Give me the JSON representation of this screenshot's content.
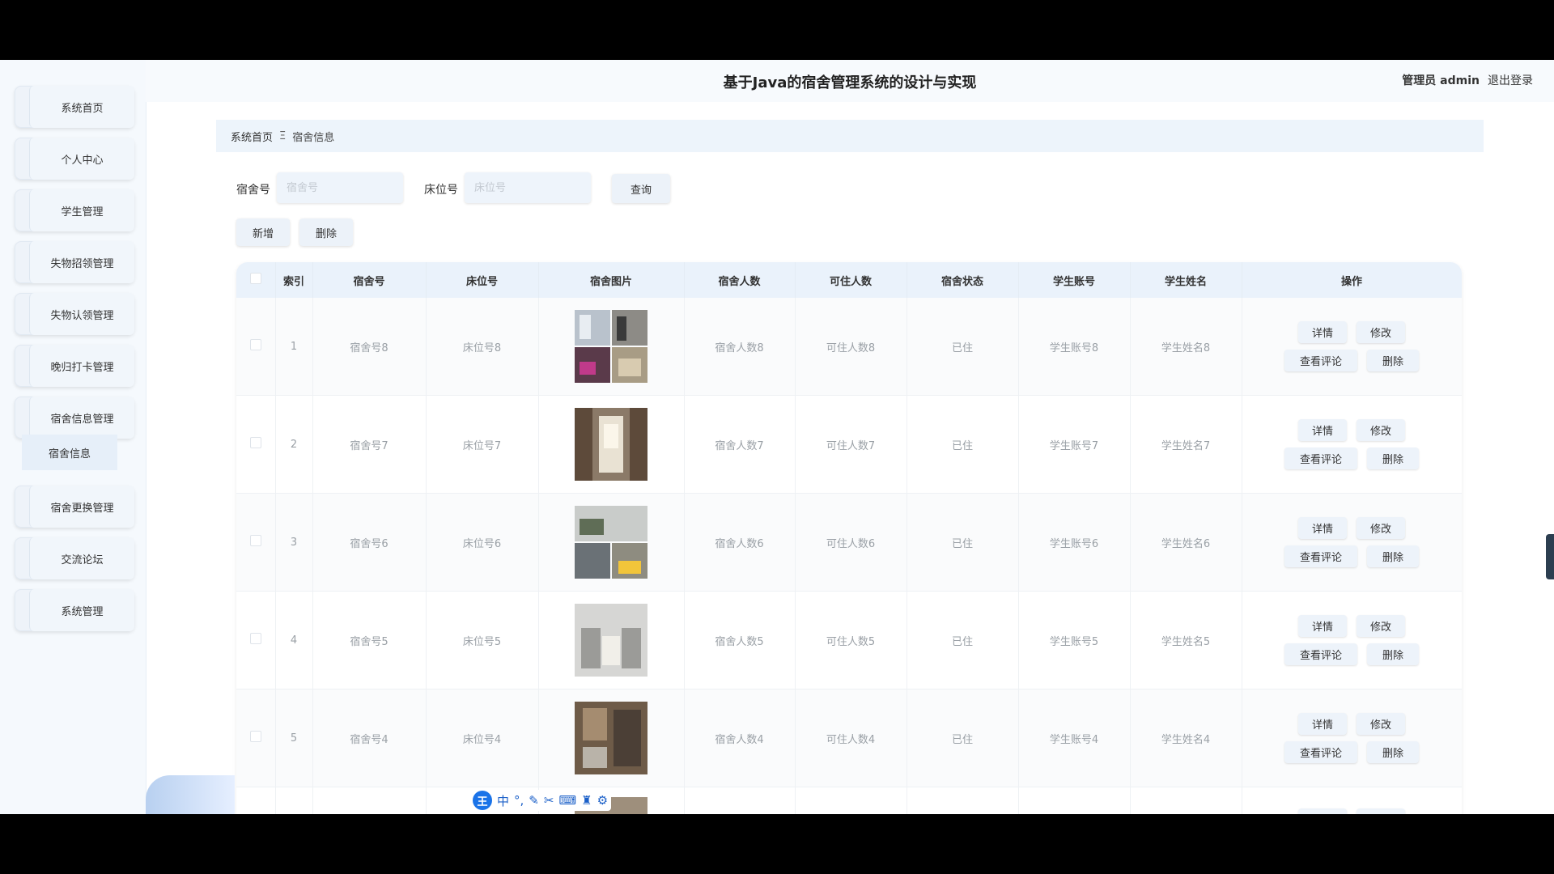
{
  "header": {
    "title": "基于Java的宿舍管理系统的设计与实现",
    "role": "管理员 admin",
    "logout": "退出登录"
  },
  "sidebar": {
    "items": [
      {
        "label": "系统首页"
      },
      {
        "label": "个人中心"
      },
      {
        "label": "学生管理"
      },
      {
        "label": "失物招领管理"
      },
      {
        "label": "失物认领管理"
      },
      {
        "label": "晚归打卡管理"
      },
      {
        "label": "宿舍信息管理"
      },
      {
        "label": "宿舍更换管理"
      },
      {
        "label": "交流论坛"
      },
      {
        "label": "系统管理"
      }
    ],
    "submenu": "宿舍信息"
  },
  "breadcrumb": {
    "home": "系统首页",
    "separator": "Ξ",
    "current": "宿舍信息"
  },
  "search": {
    "dorm_label": "宿舍号",
    "dorm_placeholder": "宿舍号",
    "bed_label": "床位号",
    "bed_placeholder": "床位号",
    "query": "查询"
  },
  "actions": {
    "add": "新增",
    "delete": "删除"
  },
  "table": {
    "headers": [
      "索引",
      "宿舍号",
      "床位号",
      "宿舍图片",
      "宿舍人数",
      "可住人数",
      "宿舍状态",
      "学生账号",
      "学生姓名",
      "操作"
    ],
    "rows": [
      {
        "index": "1",
        "dorm": "宿舍号8",
        "bed": "床位号8",
        "count": "宿舍人数8",
        "cap": "可住人数8",
        "status": "已住",
        "account": "学生账号8",
        "name": "学生姓名8"
      },
      {
        "index": "2",
        "dorm": "宿舍号7",
        "bed": "床位号7",
        "count": "宿舍人数7",
        "cap": "可住人数7",
        "status": "已住",
        "account": "学生账号7",
        "name": "学生姓名7"
      },
      {
        "index": "3",
        "dorm": "宿舍号6",
        "bed": "床位号6",
        "count": "宿舍人数6",
        "cap": "可住人数6",
        "status": "已住",
        "account": "学生账号6",
        "name": "学生姓名6"
      },
      {
        "index": "4",
        "dorm": "宿舍号5",
        "bed": "床位号5",
        "count": "宿舍人数5",
        "cap": "可住人数5",
        "status": "已住",
        "account": "学生账号5",
        "name": "学生姓名5"
      },
      {
        "index": "5",
        "dorm": "宿舍号4",
        "bed": "床位号4",
        "count": "宿舍人数4",
        "cap": "可住人数4",
        "status": "已住",
        "account": "学生账号4",
        "name": "学生姓名4"
      }
    ],
    "ops": {
      "detail": "详情",
      "edit": "修改",
      "comments": "查看评论",
      "delete": "删除"
    }
  },
  "ime": {
    "logo": "王",
    "lang": "中"
  }
}
